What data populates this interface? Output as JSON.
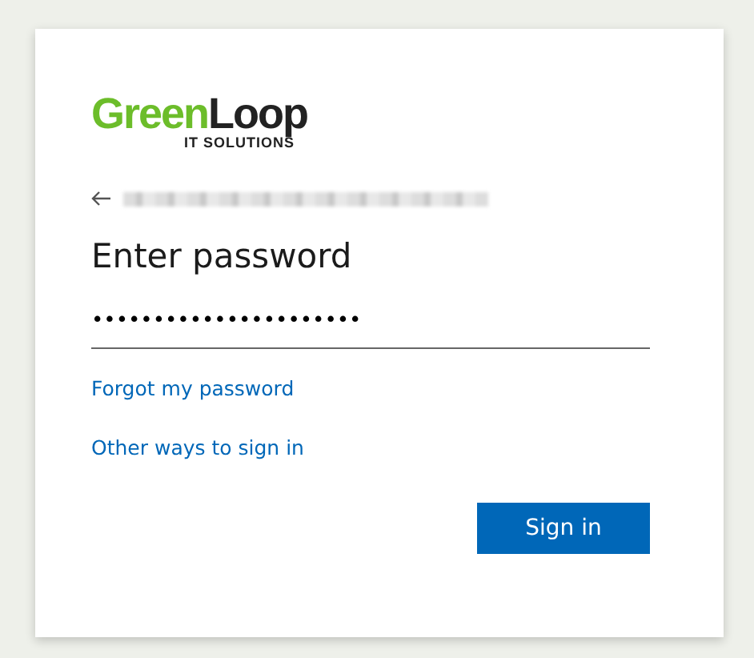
{
  "logo": {
    "primary": "Green",
    "secondary": "Loop",
    "tagline": "IT SOLUTIONS"
  },
  "account": {
    "redacted": true
  },
  "title": "Enter password",
  "password": {
    "value": "••••••••••••••••••••••"
  },
  "links": [
    "Forgot my password",
    "Other ways to sign in"
  ],
  "button": "Sign in"
}
